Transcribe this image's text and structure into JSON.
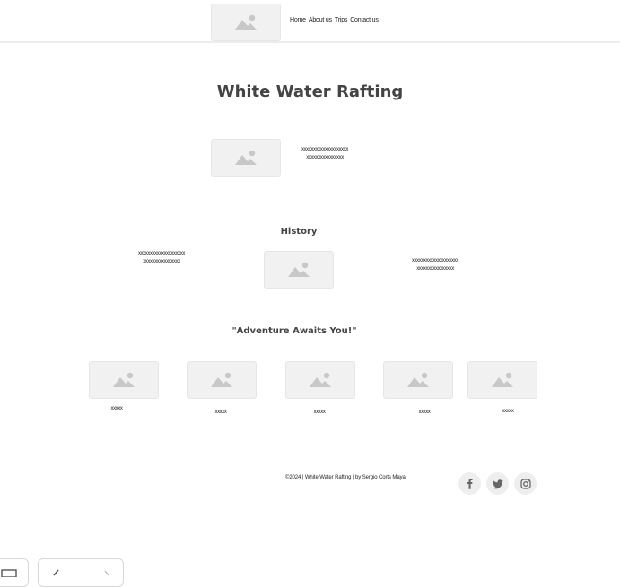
{
  "nav": {
    "logo_icon": "image-placeholder-icon",
    "links": [
      "Home",
      "About us",
      "Trips",
      "Contact us"
    ]
  },
  "hero": {
    "title": "White Water Rafting",
    "text_line1": "xxxxxxxxxxxxxxxxxxxx",
    "text_line2": "xxxxxxxxxxxxxxxx"
  },
  "history": {
    "heading": "History",
    "left_line1": "xxxxxxxxxxxxxxxxxxxx",
    "left_line2": "xxxxxxxxxxxxxxxx",
    "right_line1": "xxxxxxxxxxxxxxxxxxxx",
    "right_line2": "xxxxxxxxxxxxxxxx"
  },
  "adventure": {
    "heading": "\"Adventure Awaits You!\"",
    "items": [
      {
        "caption": "xxxxx"
      },
      {
        "caption": "xxxxx"
      },
      {
        "caption": "xxxxx"
      },
      {
        "caption": "xxxxx"
      },
      {
        "caption": "xxxxx"
      }
    ]
  },
  "footer": {
    "copyright": "©2024 | White Water Rafting | by Sergio Corts Maya",
    "social": [
      "facebook-icon",
      "twitter-icon",
      "instagram-icon"
    ]
  },
  "colors": {
    "placeholder_bg": "#f1f1f1",
    "placeholder_icon": "#c8c8c8",
    "heading": "#444444",
    "social_bg": "#eeeeee"
  }
}
